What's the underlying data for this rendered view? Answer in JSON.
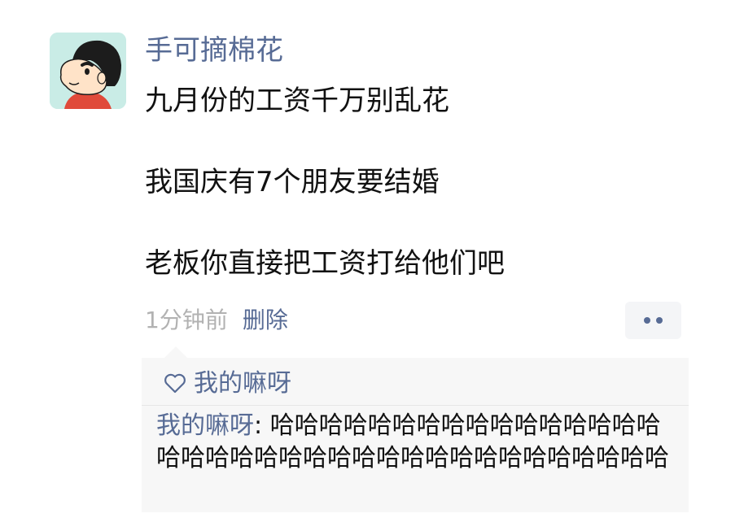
{
  "post": {
    "author": "手可摘棉花",
    "avatar_icon": "cartoon-boy-avatar-icon",
    "lines": [
      "九月份的工资千万别乱花",
      "我国庆有7个朋友要结婚",
      "老板你直接把工资打给他们吧"
    ],
    "time": "1分钟前",
    "delete_label": "删除",
    "more_icon": "two-dots-icon"
  },
  "likes": {
    "icon": "heart-outline-icon",
    "names": "我的嘛呀"
  },
  "comments": [
    {
      "user": "我的嘛呀",
      "separator": ": ",
      "text": "哈哈哈哈哈哈哈哈哈哈哈哈哈哈哈哈哈哈哈哈哈哈哈哈哈哈哈哈哈哈哈哈哈哈哈哈哈"
    }
  ],
  "colors": {
    "link": "#576b95",
    "text": "#111111",
    "meta": "#b2b2b2",
    "comment_bg": "#f7f7f7"
  }
}
